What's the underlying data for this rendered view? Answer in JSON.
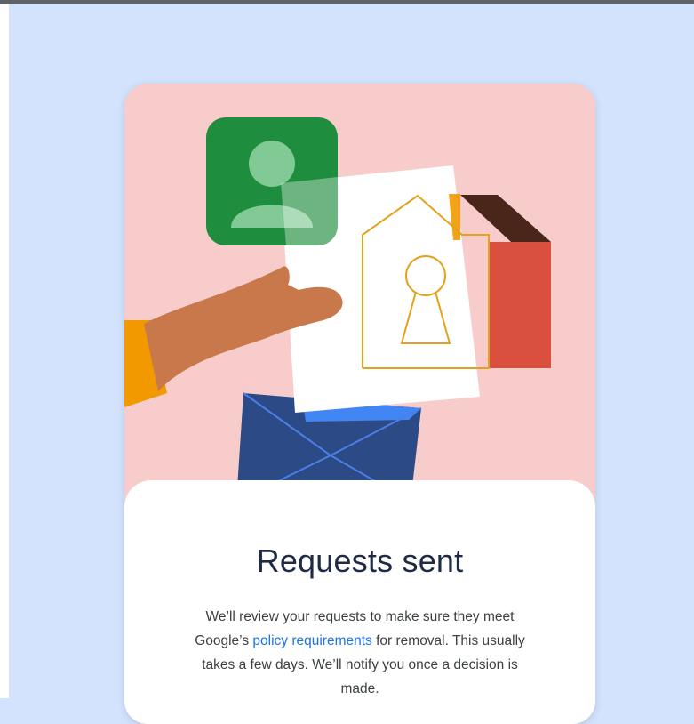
{
  "dialog": {
    "title": "Requests sent",
    "body_before_link": "We’ll review your requests to make sure they meet Google’s ",
    "link_label": "policy requirements",
    "body_after_link": " for removal. This usually takes a few days. We’ll notify you once a decision is made."
  },
  "illustration": {
    "icons": [
      "person-avatar-icon",
      "hand-icon",
      "document-icon",
      "house-keyhole-icon",
      "envelope-icon"
    ]
  },
  "colors": {
    "page_background": "#d3e3fd",
    "card_background": "#f8cccb",
    "avatar_green": "#1e8e3e",
    "house_red": "#d9503f",
    "house_roof": "#4a2519",
    "envelope_navy": "#2b4a86",
    "envelope_flap_blue": "#4285f4",
    "hand_brown": "#c8784a",
    "sleeve_yellow": "#f29900",
    "link_blue": "#1a73e8"
  }
}
